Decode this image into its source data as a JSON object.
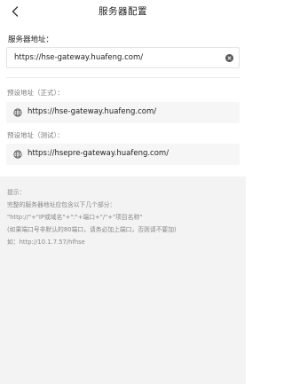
{
  "header": {
    "back_icon": "chevron-left-icon",
    "title": "服务器配置"
  },
  "server": {
    "label": "服务器地址：",
    "value": "https://hse-gateway.huafeng.com/",
    "clear_icon": "clear-icon"
  },
  "presets": [
    {
      "label": "预设地址（正式）：",
      "icon": "globe-icon",
      "url": "https://hse-gateway.huafeng.com/"
    },
    {
      "label": "预设地址（测试）：",
      "icon": "globe-icon",
      "url": "https://hsepre-gateway.huafeng.com/"
    }
  ],
  "tips": {
    "title": "提示：",
    "lines": [
      "完整的服务器地址应包含以下几个部分：",
      "\"http://\"+\"IP或域名\"+\":\"+端口+\"/\"+\"项目名称\"",
      "(如果端口号非默认的80端口，请务必加上端口，否则请不要加)",
      "如：http://10.1.7.57/hfhse"
    ]
  },
  "colors": {
    "background": "#ffffff",
    "tips_background": "#f3f3f3",
    "preset_background": "#f6f6f6",
    "text": "#222222",
    "muted": "#7a7a7a"
  }
}
